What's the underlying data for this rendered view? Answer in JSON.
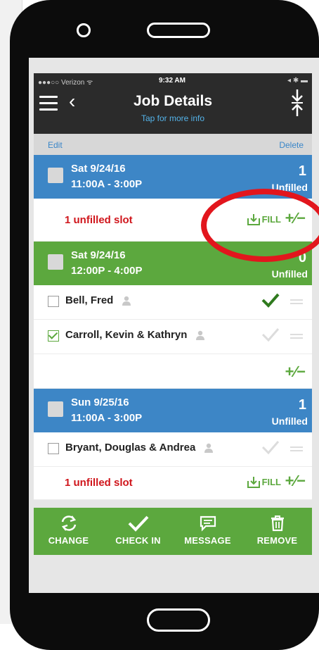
{
  "status_bar": {
    "carrier": "●●●○○ Verizon ᯤ",
    "time": "9:32 AM",
    "right": "◂ ✱ ▬"
  },
  "header": {
    "title": "Job Details",
    "subtitle": "Tap for more info"
  },
  "edit_bar": {
    "edit": "Edit",
    "delete": "Delete"
  },
  "shifts": [
    {
      "date": "Sat   9/24/16",
      "time": "11:00A - 3:00P",
      "count": "1",
      "status": "Unfilled",
      "color": "#3d86c6"
    },
    {
      "date": "Sat   9/24/16",
      "time": "12:00P - 4:00P",
      "count": "0",
      "status": "Unfilled",
      "color": "#5ca83e"
    },
    {
      "date": "Sun   9/25/16",
      "time": "11:00A - 3:00P",
      "count": "1",
      "status": "Unfilled",
      "color": "#3d86c6"
    }
  ],
  "slot_text": "1 unfilled slot",
  "fill_label": "FILL",
  "plus_minus": "+∕−",
  "people": [
    {
      "name": "Bell, Fred",
      "checked": false
    },
    {
      "name": "Carroll, Kevin & Kathryn",
      "checked": true
    },
    {
      "name": "Bryant, Douglas & Andrea",
      "checked": false
    }
  ],
  "footer": {
    "change": "CHANGE",
    "check_in": "CHECK IN",
    "message": "MESSAGE",
    "remove": "REMOVE"
  },
  "colors": {
    "accent_blue": "#3d86c6",
    "accent_green": "#5ca83e",
    "alert_red": "#d0161c",
    "highlight_ring": "#e2161d"
  }
}
